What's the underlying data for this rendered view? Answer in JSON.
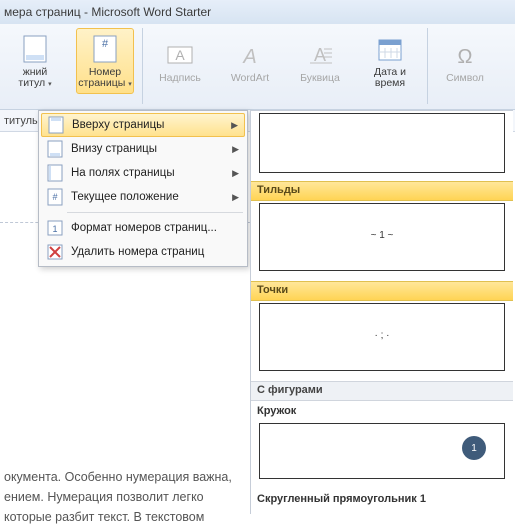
{
  "title": "мера страниц - Microsoft Word Starter",
  "ribbon": {
    "partial_btn": {
      "line1": "жний",
      "line2": "титул"
    },
    "page_number": {
      "line1": "Номер",
      "line2": "страницы"
    },
    "textbox": "Надпись",
    "wordart": "WordArt",
    "dropcap": "Буквица",
    "datetime": {
      "line1": "Дата и",
      "line2": "время"
    },
    "symbol": "Символ"
  },
  "tabstrip": "титулы",
  "menu": {
    "top": "Вверху страницы",
    "bottom": "Внизу страницы",
    "margins": "На полях страницы",
    "current": "Текущее положение",
    "format": "Формат номеров страниц...",
    "remove": "Удалить номера страниц"
  },
  "gallery": {
    "tildes_hdr": "Тильды",
    "tildes_sample": "~ 1 ~",
    "dots_hdr": "Точки",
    "dots_sample": "· ; ·",
    "shapes_hdr": "С фигурами",
    "circle_lbl": "Кружок",
    "circle_num": "1",
    "roundrect_lbl": "Скругленный прямоугольник 1"
  },
  "doctext": {
    "l1": "окумента. Особенно нумерация важна,",
    "l2": "ением. Нумерация позволит легко",
    "l3": "которые разбит текст. В текстовом"
  }
}
